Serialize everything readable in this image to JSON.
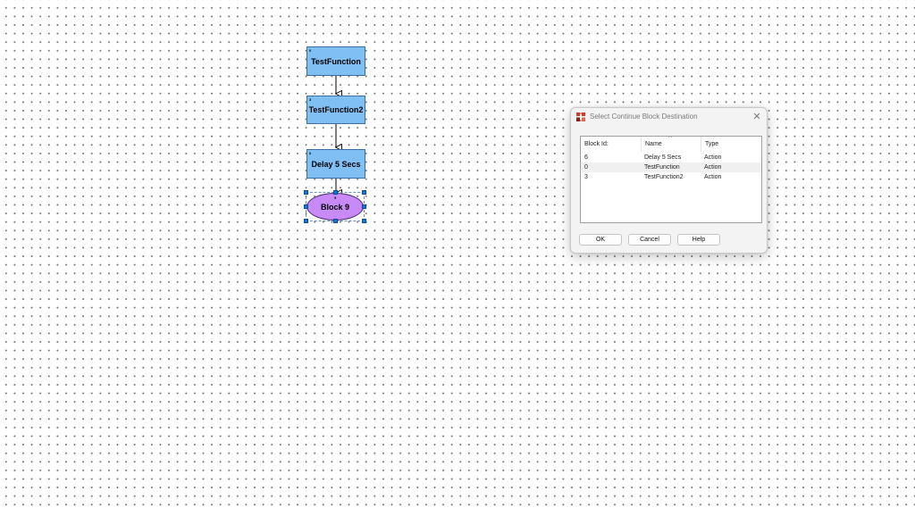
{
  "flowchart": {
    "blocks": [
      {
        "id": "0",
        "label": "TestFunction"
      },
      {
        "id": "3",
        "label": "TestFunction2"
      },
      {
        "id": "6",
        "label": "Delay 5 Secs"
      },
      {
        "id": "9",
        "label": "Block 9"
      }
    ],
    "colors": {
      "action_block_fill": "#80bff4",
      "end_block_fill": "#c78af7",
      "selection_handle": "#1a73d6"
    }
  },
  "dialog": {
    "title": "Select Continue Block Destination",
    "icon": "app-flowchart-icon",
    "close_glyph": "✕",
    "columns": [
      "Block Id:",
      "Name",
      "Type"
    ],
    "sort_indicator": "^",
    "rows": [
      {
        "id": "6",
        "name": "Delay 5 Secs",
        "type": "Action"
      },
      {
        "id": "0",
        "name": "TestFunction",
        "type": "Action"
      },
      {
        "id": "3",
        "name": "TestFunction2",
        "type": "Action"
      }
    ],
    "buttons": {
      "ok": "OK",
      "cancel": "Cancel",
      "help": "Help"
    }
  }
}
